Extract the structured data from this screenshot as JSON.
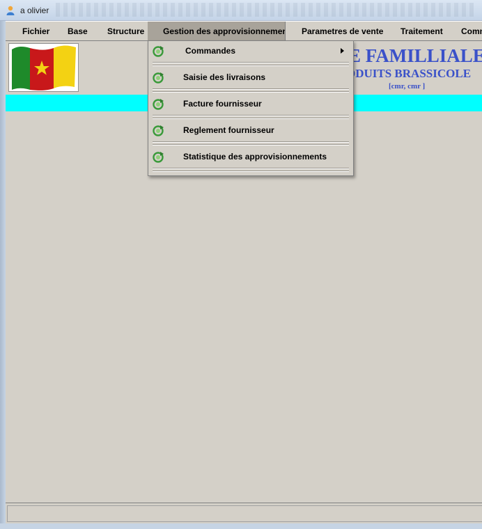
{
  "window": {
    "title": "a olivier"
  },
  "menubar": {
    "items": [
      {
        "label": "Fichier"
      },
      {
        "label": "Base"
      },
      {
        "label": "Structure"
      },
      {
        "label": "Gestion des approvisionnements"
      },
      {
        "label": "Parametres de vente"
      },
      {
        "label": "Traitement"
      },
      {
        "label": "Comm"
      }
    ],
    "active_index": 3
  },
  "banner": {
    "line1": "E FAMILLIALE",
    "line2": "ODUITS BRASSICOLE",
    "line3": "[cmr, cmr                ]"
  },
  "dropdown": {
    "items": [
      {
        "label": "Commandes",
        "has_submenu": true,
        "icon": "refresh-icon"
      },
      {
        "label": "Saisie des livraisons",
        "has_submenu": false,
        "icon": "refresh-icon"
      },
      {
        "label": "Facture fournisseur",
        "has_submenu": false,
        "icon": "refresh-icon"
      },
      {
        "label": "Reglement fournisseur",
        "has_submenu": false,
        "icon": "refresh-icon"
      },
      {
        "label": "Statistique des approvisionnements",
        "has_submenu": false,
        "icon": "refresh-icon"
      }
    ]
  },
  "colors": {
    "banner_text": "#3a51c9",
    "cyan_bar": "#00ffff",
    "panel": "#d4d0c8",
    "flag_green": "#1e8a2a",
    "flag_red": "#c8181a",
    "flag_yellow": "#f3d213"
  }
}
